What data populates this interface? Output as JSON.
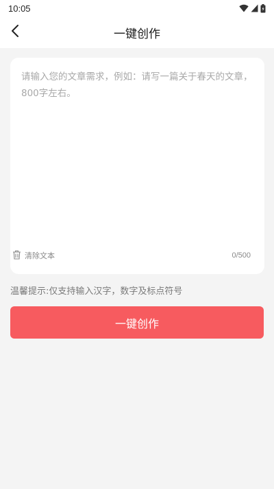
{
  "status_bar": {
    "time": "10:05",
    "icons": [
      "wifi-icon",
      "signal-icon",
      "battery-icon"
    ]
  },
  "header": {
    "back_icon": "chevron-left-icon",
    "title": "一键创作"
  },
  "editor": {
    "value": "",
    "placeholder": "请输入您的文章需求，例如：请写一篇关于春天的文章，800字左右。",
    "clear_icon": "trash-icon",
    "clear_label": "清除文本",
    "counter": "0/500"
  },
  "tip": "温馨提示:仅支持输入汉字，数字及标点符号",
  "action": {
    "label": "一键创作"
  },
  "colors": {
    "accent": "#f75b5f",
    "background": "#f4f4f4",
    "card": "#ffffff"
  }
}
